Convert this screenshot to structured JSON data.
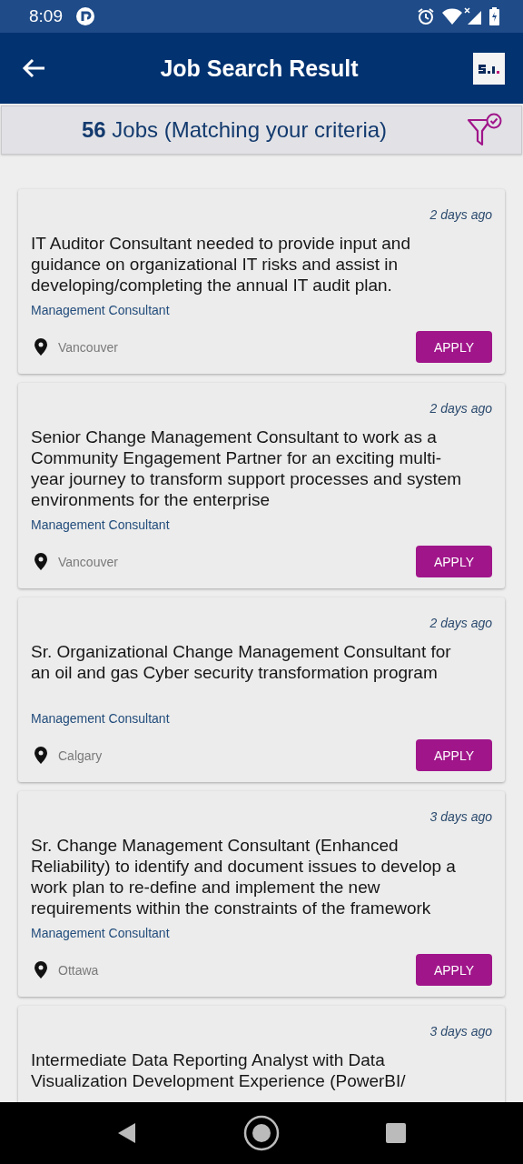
{
  "status_bar": {
    "time": "8:09"
  },
  "app_bar": {
    "title": "Job Search Result"
  },
  "summary": {
    "text": "**56** Jobs (Matching your criteria)"
  },
  "jobs": [
    {
      "posted": "2 days ago",
      "title": "IT Auditor Consultant needed to provide input and guidance on organizational IT risks and assist in developing/completing the annual IT audit plan.",
      "category": "Management Consultant",
      "location": "Vancouver",
      "action": "APPLY"
    },
    {
      "posted": "2 days ago",
      "title": "Senior Change Management Consultant to work as a Community Engagement Partner for an exciting multi-year journey to transform  support processes and system environments for the enterprise",
      "category": "Management Consultant",
      "location": "Vancouver",
      "action": "APPLY"
    },
    {
      "posted": "2 days ago",
      "title": "Sr. Organizational Change Management Consultant for an oil and gas Cyber security transformation program",
      "category": "Management Consultant",
      "location": "Calgary",
      "action": "APPLY"
    },
    {
      "posted": "3 days ago",
      "title": "Sr. Change Management Consultant (Enhanced Reliability) to identify and document issues to develop a work plan to re-define and implement the new requirements within the constraints of the framework",
      "category": "Management Consultant",
      "location": "Ottawa",
      "action": "APPLY"
    },
    {
      "posted": "3 days ago",
      "title": "Intermediate Data Reporting Analyst with Data Visualization Development  Experience (PowerBI/"
    }
  ]
}
